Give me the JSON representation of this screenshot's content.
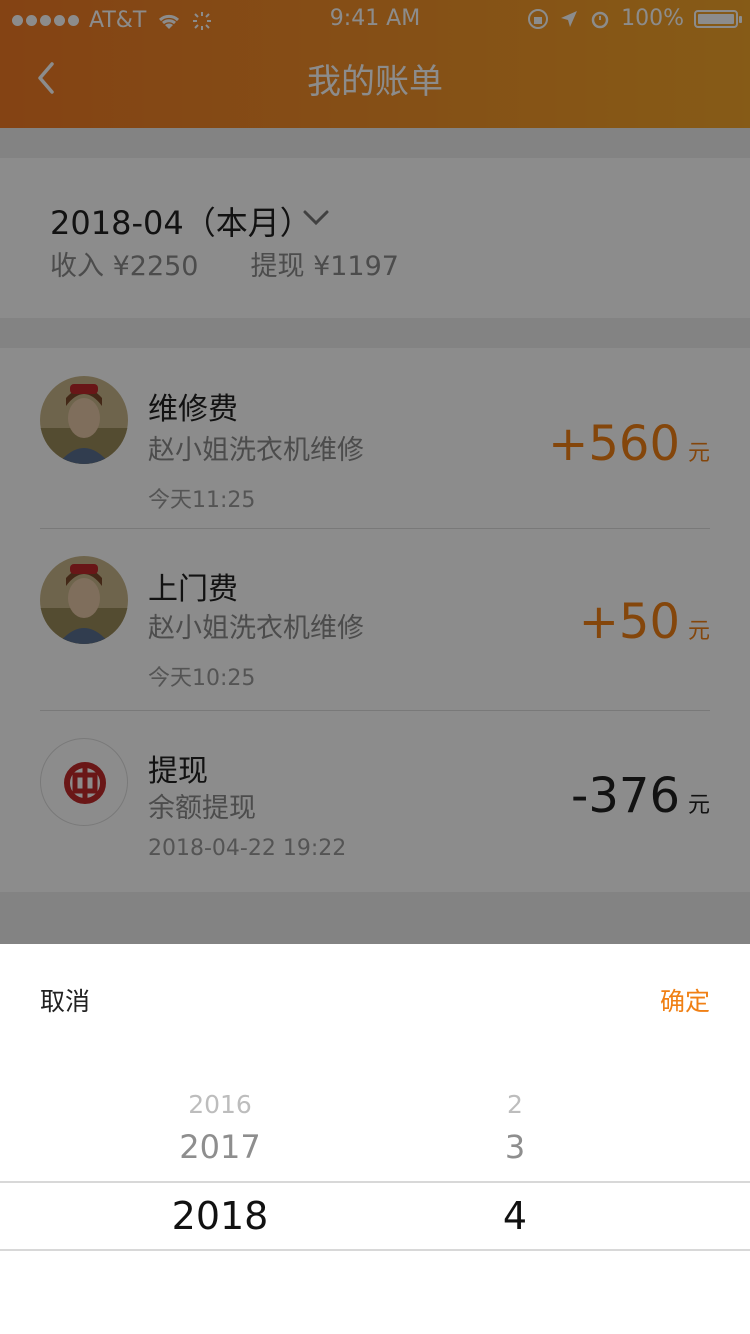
{
  "status_bar": {
    "carrier": "AT&T",
    "time": "9:41 AM",
    "battery": "100%"
  },
  "header": {
    "title": "我的账单"
  },
  "summary": {
    "month": "2018-04（本月）",
    "income": "收入 ¥2250",
    "withdraw": "提现 ¥1197"
  },
  "transactions": [
    {
      "title": "维修费",
      "subtitle": "赵小姐洗衣机维修",
      "time": "今天11:25",
      "amount": "+560",
      "unit": "元"
    },
    {
      "title": "上门费",
      "subtitle": "赵小姐洗衣机维修",
      "time": "今天10:25",
      "amount": "+50",
      "unit": "元"
    },
    {
      "title": "提现",
      "subtitle": "余额提现",
      "time": "2018-04-22  19:22",
      "amount": "-376",
      "unit": "元"
    }
  ],
  "picker": {
    "cancel": "取消",
    "confirm": "确定",
    "years": [
      "2016",
      "2017",
      "2018"
    ],
    "months": [
      "2",
      "3",
      "4"
    ]
  },
  "colors": {
    "accent": "#f08015",
    "header_start": "#f07a26",
    "header_end": "#f5a62a",
    "bank_red": "#c12a2a"
  },
  "icons": {
    "back": "chevron-left-icon",
    "dropdown": "chevron-down-icon",
    "bank": "bank-of-china-icon"
  }
}
